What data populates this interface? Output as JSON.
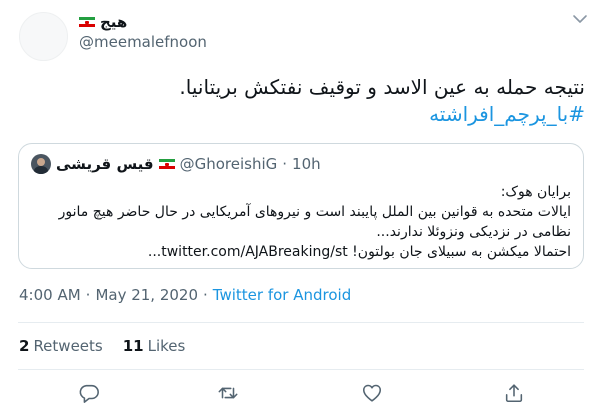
{
  "author": {
    "display_name": "هیج",
    "handle": "@meemalefnoon"
  },
  "tweet": {
    "text": "نتیجه حمله به عین الاسد و توقیف نفتکش بریتانیا.",
    "hashtag": "#با_پرچم_افراشته"
  },
  "quoted": {
    "name": "قیس قریشی",
    "handle": "@GhoreishiG",
    "dot": "·",
    "time": "10h",
    "lines": [
      "برایان هوک:",
      "ایالات متحده به قوانین بین الملل پایبند است و نیروهای آمریکایی در حال حاضر هیچ مانور",
      "نظامی در نزدیکی ونزوئلا ندارند...",
      "احتمالا میکشن به سبیلای جان بولتون! twitter.com/AJABreaking/st..."
    ]
  },
  "meta": {
    "time": "4:00 AM",
    "dot1": "·",
    "date": "May 21, 2020",
    "dot2": "·",
    "source": "Twitter for Android"
  },
  "stats": {
    "retweets_count": "2",
    "retweets_label": "Retweets",
    "likes_count": "11",
    "likes_label": "Likes"
  },
  "icons": {
    "caret": "chevron-down-icon",
    "reply": "reply-icon",
    "retweet": "retweet-icon",
    "like": "heart-icon",
    "share": "share-icon"
  },
  "colors": {
    "accent": "#1b95e0",
    "text": "#0f1419",
    "muted": "#536471",
    "border": "#cfd9de",
    "divider": "#e6ecf0"
  }
}
